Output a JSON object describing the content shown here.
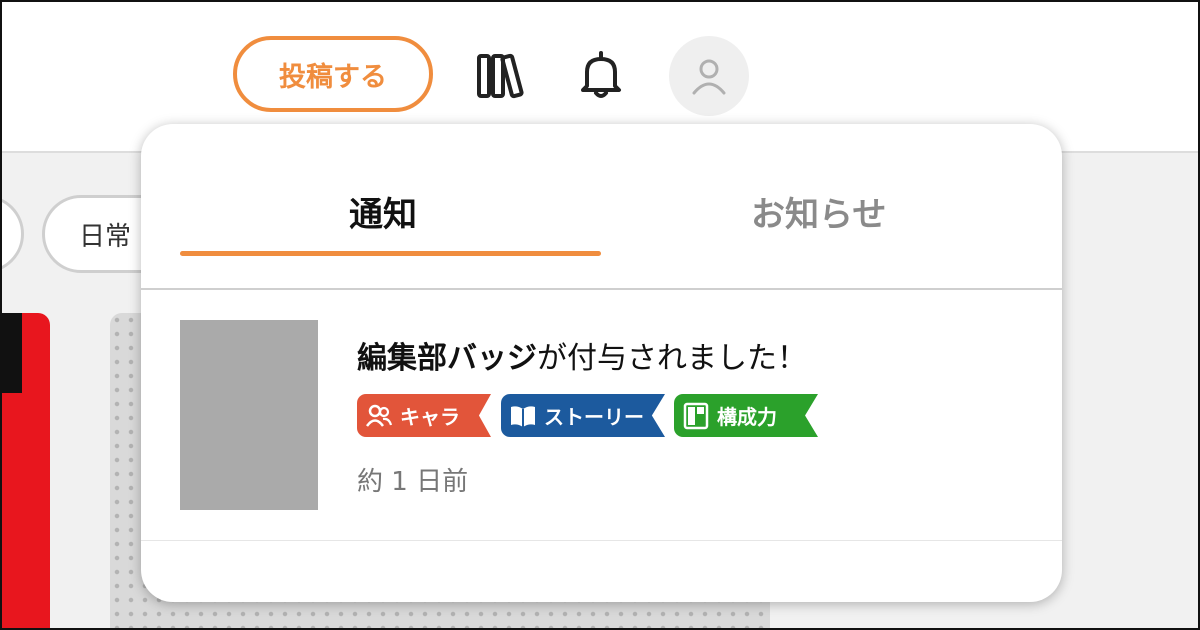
{
  "header": {
    "post_button_label": "投稿する",
    "library_icon": "library-icon",
    "bell_icon": "bell-icon",
    "avatar_icon": "user-icon"
  },
  "filters": {
    "daily_label": "日常"
  },
  "notifications_panel": {
    "tabs": [
      {
        "label": "通知",
        "active": true
      },
      {
        "label": "お知らせ",
        "active": false
      }
    ],
    "items": [
      {
        "title_bold": "編集部バッジ",
        "title_rest": "が付与されました！",
        "badges": [
          {
            "label": "キャラ",
            "icon": "characters-icon",
            "color": "#e2553a"
          },
          {
            "label": "ストーリー",
            "icon": "book-icon",
            "color": "#1c5a9e"
          },
          {
            "label": "構成力",
            "icon": "layout-icon",
            "color": "#2ba12b"
          }
        ],
        "time": "約 1 日前"
      }
    ]
  },
  "colors": {
    "accent": "#f08d3e",
    "inactive_tab": "#8a8a8a",
    "background": "#f1f1f1"
  }
}
